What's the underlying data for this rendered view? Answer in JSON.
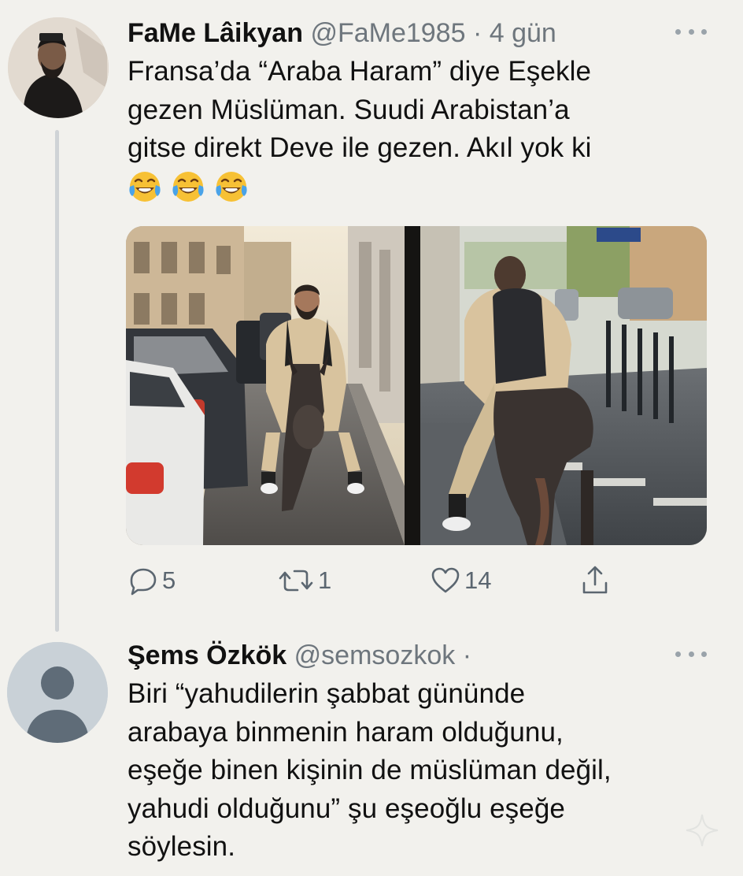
{
  "tweets": [
    {
      "display_name": "FaMe Lâikyan",
      "handle": "@FaMe1985",
      "separator": "·",
      "time": "4 gün",
      "text_lines": [
        "Fransa’da “Araba Haram” diye Eşekle",
        "gezen Müslüman. Suudi Arabistan’a",
        "gitse direkt Deve ile gezen. Akıl yok ki"
      ],
      "emoji": [
        "face-with-tears-of-joy",
        "face-with-tears-of-joy",
        "face-with-tears-of-joy"
      ],
      "actions": {
        "reply_count": "5",
        "retweet_count": "1",
        "like_count": "14"
      }
    },
    {
      "display_name": "Şems Özkök",
      "handle": "@semsozkok",
      "separator": "·",
      "text_lines": [
        "Biri “yahudilerin şabbat gününde",
        "arabaya binmenin haram olduğunu,",
        "eşeğe binen kişinin de müslüman değil,",
        "yahudi olduğunu” şu eşeoğlu eşeğe",
        "söylesin."
      ]
    }
  ],
  "icons": {
    "reply": "speech-bubble-icon",
    "retweet": "retweet-arrows-icon",
    "like": "heart-outline-icon",
    "share": "share-upload-icon",
    "more": "more-dots-icon"
  },
  "colors": {
    "background": "#f2f1ed",
    "text": "#111111",
    "secondary": "#6e767d",
    "icon": "#5b6670",
    "thread_line": "#cfd3d6"
  }
}
